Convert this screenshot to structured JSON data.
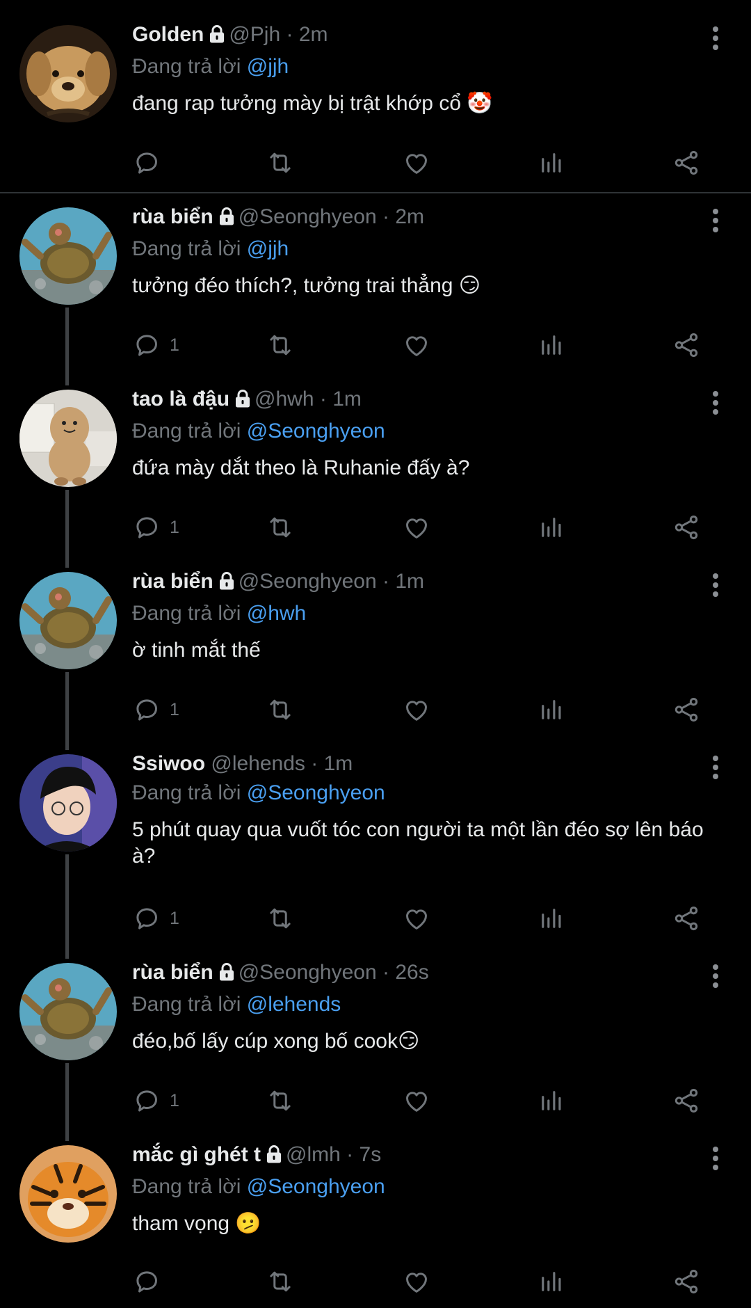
{
  "reply_prefix": "Đang trả lời",
  "tweets": [
    {
      "name": "Golden",
      "handle": "@Pjh",
      "sep": "·",
      "time": "2m",
      "reply_to": "@jjh",
      "text": "đang rap tưởng mày bị trật khớp cổ 🤡",
      "replies": "",
      "avatar": "puppy",
      "locked": true
    },
    {
      "name": "rùa biển",
      "handle": "@Seonghyeon",
      "sep": "·",
      "time": "2m",
      "reply_to": "@jjh",
      "text": "tưởng đéo thích?, tưởng trai thẳng 😏",
      "replies": "1",
      "avatar": "turtle",
      "locked": true
    },
    {
      "name": "tao là đậu",
      "handle": "@hwh",
      "sep": "·",
      "time": "1m",
      "reply_to": "@Seonghyeon",
      "text": "đứa mày dắt theo là Ruhanie đấy à?",
      "replies": "1",
      "avatar": "peanut",
      "locked": true
    },
    {
      "name": "rùa biển",
      "handle": "@Seonghyeon",
      "sep": "·",
      "time": "1m",
      "reply_to": "@hwh",
      "text": "ờ tinh mắt thế",
      "replies": "1",
      "avatar": "turtle",
      "locked": true
    },
    {
      "name": "Ssiwoo",
      "handle": "@lehends",
      "sep": "·",
      "time": "1m",
      "reply_to": "@Seonghyeon",
      "text": "5 phút quay qua vuốt tóc con người ta một lần đéo sợ lên báo à?",
      "replies": "1",
      "avatar": "person",
      "locked": false
    },
    {
      "name": "rùa biển",
      "handle": "@Seonghyeon",
      "sep": "·",
      "time": "26s",
      "reply_to": "@lehends",
      "text": "đéo,bố lấy cúp xong bố cook😏",
      "replies": "1",
      "avatar": "turtle",
      "locked": true
    },
    {
      "name": "mắc gì ghét t",
      "handle": "@lmh",
      "sep": "·",
      "time": "7s",
      "reply_to": "@Seonghyeon",
      "text": "tham vọng 🫤",
      "replies": "",
      "avatar": "tiger",
      "locked": true
    }
  ],
  "icons": {
    "reply": "reply-icon",
    "retweet": "retweet-icon",
    "like": "heart-icon",
    "views": "views-icon",
    "share": "share-icon",
    "more": "more-options-icon",
    "lock": "lock-icon"
  },
  "colors": {
    "background": "#000000",
    "text": "#e7e9ea",
    "secondary": "#71767b",
    "mention": "#4a9ff0",
    "thread_line": "#3e4144"
  }
}
